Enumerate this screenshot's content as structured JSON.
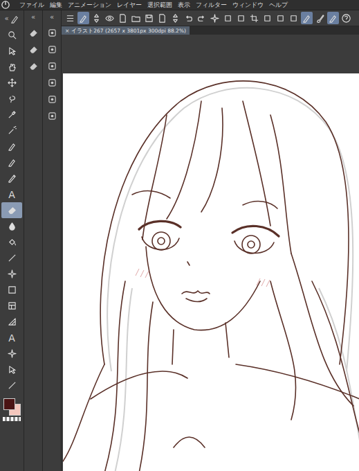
{
  "window": {
    "app": "Clip Studio Paint"
  },
  "menu": [
    "ファイル",
    "編集",
    "アニメーション",
    "レイヤー",
    "選択範囲",
    "表示",
    "フィルター",
    "ウィンドウ",
    "ヘルプ"
  ],
  "panel_toggles": [
    "«",
    "«",
    "«"
  ],
  "tools": [
    {
      "kind": "zoom",
      "label": "",
      "selected": false
    },
    {
      "kind": "select",
      "label": "",
      "selected": false
    },
    {
      "kind": "hand",
      "label": "",
      "selected": false
    },
    {
      "kind": "move",
      "label": "",
      "selected": false
    },
    {
      "kind": "lasso",
      "label": "",
      "selected": false
    },
    {
      "kind": "eyedropper",
      "label": "",
      "selected": false
    },
    {
      "kind": "wand",
      "label": "",
      "selected": false
    },
    {
      "kind": "pen",
      "label": "",
      "selected": false
    },
    {
      "kind": "pen",
      "label": "",
      "selected": false
    },
    {
      "kind": "pencil",
      "label": "",
      "selected": false
    },
    {
      "kind": "text",
      "label": "A",
      "selected": false
    },
    {
      "kind": "eraser",
      "label": "",
      "selected": true
    },
    {
      "kind": "drop",
      "label": "",
      "selected": false
    },
    {
      "kind": "fill",
      "label": "",
      "selected": false
    },
    {
      "kind": "line",
      "label": "",
      "selected": false
    },
    {
      "kind": "spark",
      "label": "",
      "selected": false
    },
    {
      "kind": "gradient",
      "label": "",
      "selected": false
    },
    {
      "kind": "frame",
      "label": "",
      "selected": false
    },
    {
      "kind": "ruler",
      "label": "",
      "selected": false
    },
    {
      "kind": "text",
      "label": "A",
      "selected": false
    },
    {
      "kind": "spark",
      "label": "",
      "selected": false
    },
    {
      "kind": "select",
      "label": "",
      "selected": false
    },
    {
      "kind": "line",
      "label": "",
      "selected": false
    }
  ],
  "colors": {
    "main": "#4a1414",
    "sub": "#f4c6bc"
  },
  "subtools": [
    {
      "selected": false
    },
    {
      "selected": false
    },
    {
      "selected": false
    }
  ],
  "side_icons": [
    {
      "selected": false
    },
    {
      "selected": false
    },
    {
      "selected": false
    },
    {
      "selected": false
    },
    {
      "selected": false
    },
    {
      "selected": false
    }
  ],
  "toolbar": [
    {
      "kind": "menu",
      "selected": false
    },
    {
      "kind": "pen",
      "selected": true
    },
    {
      "kind": "arrows",
      "selected": false
    },
    {
      "kind": "eye",
      "selected": false
    },
    {
      "kind": "doc",
      "selected": false
    },
    {
      "kind": "folder",
      "selected": false
    },
    {
      "kind": "save",
      "selected": false
    },
    {
      "kind": "doc",
      "selected": false
    },
    {
      "kind": "arrows",
      "selected": false
    },
    {
      "kind": "undo",
      "selected": false
    },
    {
      "kind": "redo",
      "selected": false
    },
    {
      "kind": "spark",
      "selected": false
    },
    {
      "kind": "square",
      "selected": false
    },
    {
      "kind": "square",
      "selected": false
    },
    {
      "kind": "crop",
      "selected": false
    },
    {
      "kind": "square",
      "selected": false
    },
    {
      "kind": "square",
      "selected": false
    },
    {
      "kind": "square",
      "selected": false
    },
    {
      "kind": "pen",
      "selected": true
    },
    {
      "kind": "brush",
      "selected": false
    },
    {
      "kind": "pen",
      "selected": true
    },
    {
      "kind": "help",
      "selected": false
    }
  ],
  "tab": {
    "close": "×",
    "label": "イラスト267 (2657 x 3801px 300dpi 88.2%)",
    "selected": true
  }
}
